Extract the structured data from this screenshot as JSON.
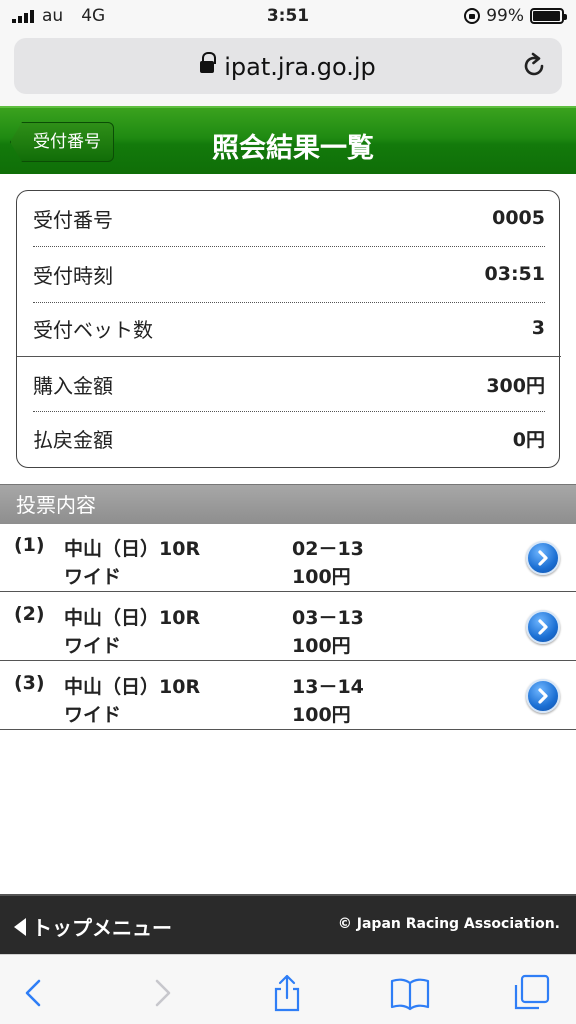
{
  "status": {
    "carrier": "au",
    "network": "4G",
    "time": "3:51",
    "battery": "99%"
  },
  "browser": {
    "url": "ipat.jra.go.jp"
  },
  "header": {
    "back_label": "受付番号",
    "title": "照会結果一覧"
  },
  "receipt": {
    "rows": [
      {
        "label": "受付番号",
        "value": "0005"
      },
      {
        "label": "受付時刻",
        "value": "03:51"
      },
      {
        "label": "受付ベット数",
        "value": "3"
      },
      {
        "label": "購入金額",
        "value": "300円"
      },
      {
        "label": "払戻金額",
        "value": "0円"
      }
    ]
  },
  "section_title": "投票内容",
  "bets": [
    {
      "num": "(1)",
      "race": "中山（日）10R",
      "type": "ワイド",
      "combo": "02－13",
      "amount": "100円"
    },
    {
      "num": "(2)",
      "race": "中山（日）10R",
      "type": "ワイド",
      "combo": "03－13",
      "amount": "100円"
    },
    {
      "num": "(3)",
      "race": "中山（日）10R",
      "type": "ワイド",
      "combo": "13－14",
      "amount": "100円"
    }
  ],
  "footer": {
    "top_menu": "トップメニュー",
    "copyright": "© Japan Racing Association."
  },
  "icons": {
    "signal": "signal-bars-icon",
    "lock": "padlock-icon",
    "reload": "reload-icon",
    "detail": "chevron-right-circle-icon",
    "back": "chevron-left-icon",
    "forward": "chevron-right-icon",
    "share": "share-icon",
    "bookmarks": "book-icon",
    "tabs": "tabs-icon"
  },
  "colors": {
    "header_green": "#1f8a12",
    "detail_blue": "#1b6fd3",
    "section_gray": "#999999",
    "footer_dark": "#2a2a2a"
  }
}
